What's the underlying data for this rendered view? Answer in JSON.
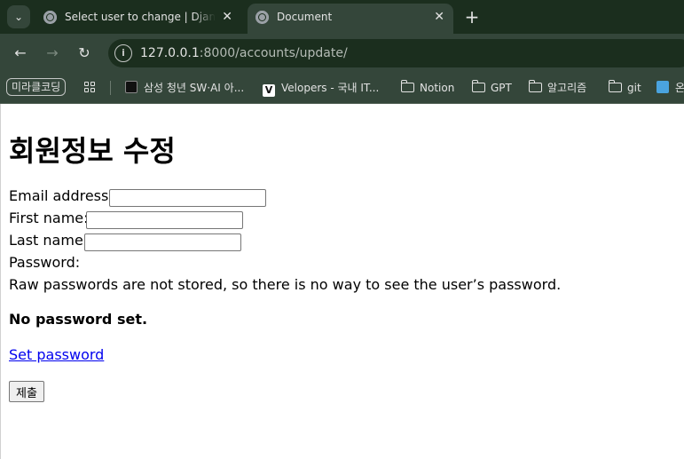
{
  "browser": {
    "tabs": [
      {
        "title": "Select user to change | Django",
        "active": false
      },
      {
        "title": "Document",
        "active": true
      }
    ],
    "new_tab_label": "+",
    "url_host": "127.0.0.1",
    "url_path": ":8000/accounts/update/",
    "bookmarks": [
      {
        "label": "미라클코딩",
        "kind": "pill"
      },
      {
        "label": "삼성 청년 SW·AI 아...",
        "kind": "site",
        "icon": "ssafy-icon"
      },
      {
        "label": "Velopers - 국내 IT...",
        "kind": "site",
        "icon": "velog-icon"
      },
      {
        "label": "Notion",
        "kind": "folder"
      },
      {
        "label": "GPT",
        "kind": "folder"
      },
      {
        "label": "알고리즘",
        "kind": "folder"
      },
      {
        "label": "git",
        "kind": "folder"
      },
      {
        "label": "온",
        "kind": "site",
        "icon": "bookmark-site-icon"
      }
    ]
  },
  "page": {
    "heading": "회원정보 수정",
    "fields": [
      {
        "label": "Email address:",
        "value": ""
      },
      {
        "label": "First name:",
        "value": ""
      },
      {
        "label": "Last name:",
        "value": ""
      }
    ],
    "password_label": "Password:",
    "password_help": "Raw passwords are not stored, so there is no way to see the user’s password.",
    "password_status": "No password set.",
    "set_password_link": "Set password",
    "submit_label": "제출"
  },
  "colors": {
    "tabstrip_bg": "#1b2e1e",
    "toolbar_bg": "#34463a",
    "link": "#0000ee"
  }
}
